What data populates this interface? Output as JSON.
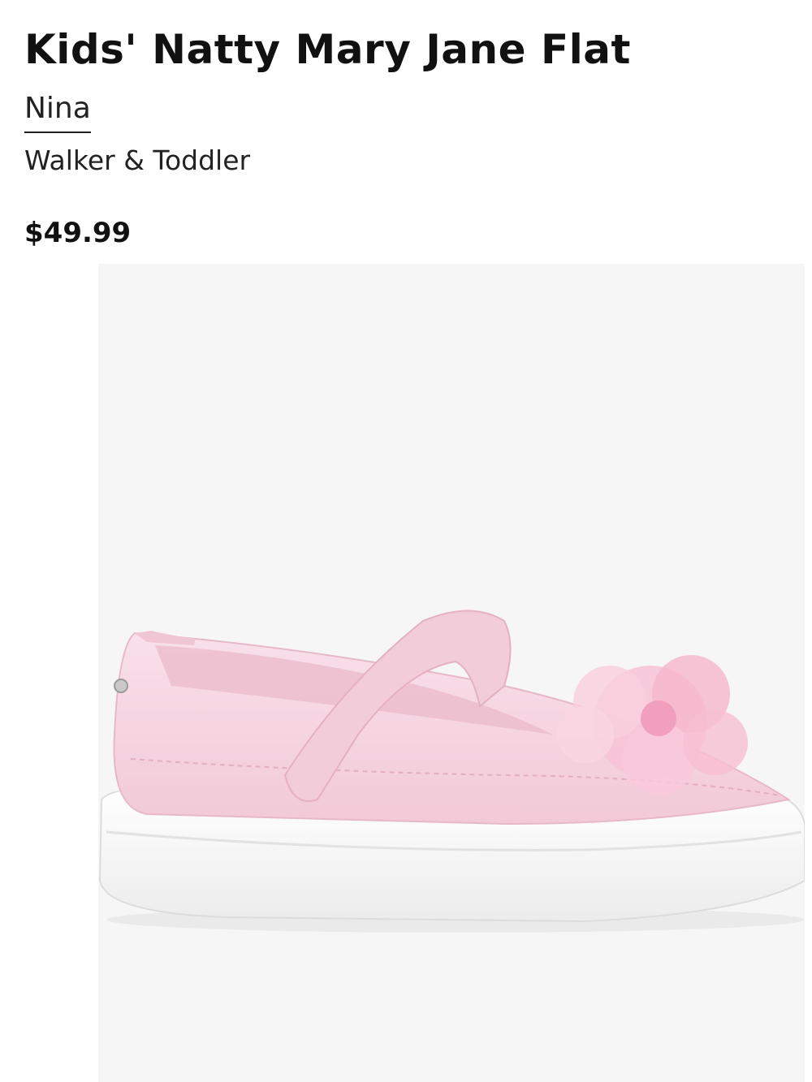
{
  "product": {
    "title": "Kids' Natty Mary Jane Flat",
    "brand": "Nina",
    "category": "Walker & Toddler",
    "price": "$49.99"
  },
  "image": {
    "subject": "product-photo",
    "colors": {
      "background": "#f6f6f6",
      "upper": "#f6d3df",
      "sole": "#fdfdfd",
      "flower": "#f7b8cf"
    }
  }
}
